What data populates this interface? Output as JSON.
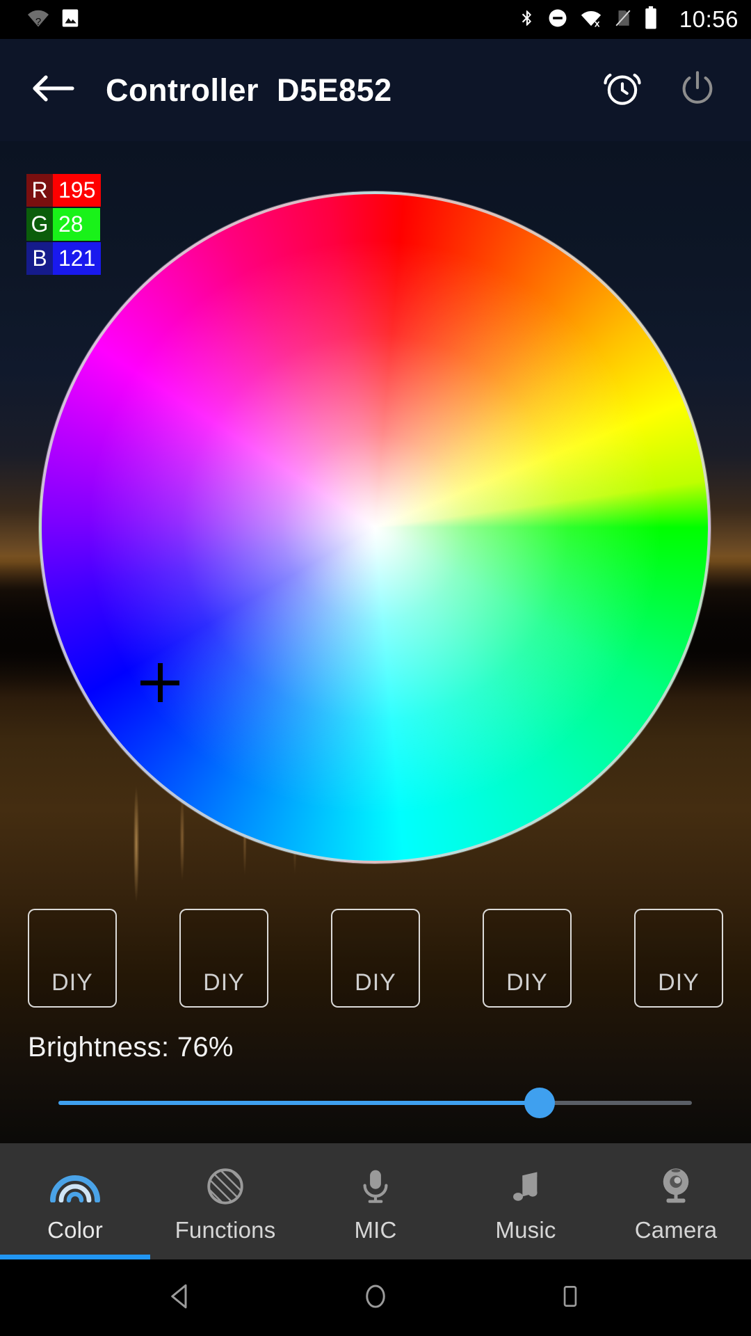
{
  "status_bar": {
    "time": "10:56",
    "left_icons": [
      "wifi-unknown-icon",
      "screenshot-image-icon"
    ],
    "right_icons": [
      "bluetooth-icon",
      "do-not-disturb-icon",
      "wifi-off-icon",
      "sim-missing-icon",
      "battery-icon"
    ]
  },
  "app_bar": {
    "back_icon": "back-arrow-icon",
    "title": "Controller  D5E852",
    "alarm_icon": "alarm-clock-icon",
    "power_icon": "power-icon"
  },
  "rgb_readout": [
    {
      "key": "R",
      "value": "195",
      "key_bg": "#7a0f0f",
      "value_bg": "#fe0000"
    },
    {
      "key": "G",
      "value": "28",
      "key_bg": "#0b5d0b",
      "value_bg": "#19f219"
    },
    {
      "key": "B",
      "value": "121",
      "key_bg": "#151b8b",
      "value_bg": "#1919ee"
    }
  ],
  "color_wheel": {
    "cursor_label": "color-picker-crosshair",
    "selected_hex": "#C31C79"
  },
  "presets": {
    "buttons": [
      {
        "label": "DIY"
      },
      {
        "label": "DIY"
      },
      {
        "label": "DIY"
      },
      {
        "label": "DIY"
      },
      {
        "label": "DIY"
      }
    ]
  },
  "brightness": {
    "label": "Brightness: 76%",
    "percent": 76,
    "fill_color": "#3fa0ef",
    "track_color": "#5a5f66"
  },
  "tabs": [
    {
      "label": "Color",
      "icon": "rainbow-icon",
      "active": true
    },
    {
      "label": "Functions",
      "icon": "hatched-circle-icon",
      "active": false
    },
    {
      "label": "MIC",
      "icon": "microphone-icon",
      "active": false
    },
    {
      "label": "Music",
      "icon": "music-note-icon",
      "active": false
    },
    {
      "label": "Camera",
      "icon": "webcam-icon",
      "active": false
    }
  ],
  "android_nav": {
    "back": "nav-back-triangle-icon",
    "home": "nav-home-circle-icon",
    "recents": "nav-recents-square-icon"
  }
}
